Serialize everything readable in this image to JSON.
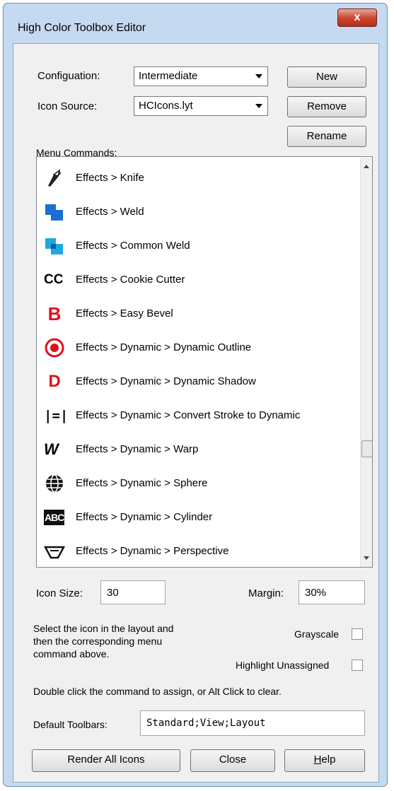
{
  "window": {
    "title": "High Color Toolbox Editor",
    "close_glyph": "x"
  },
  "config": {
    "configuration_label": "Configuation:",
    "configuration_value": "Intermediate",
    "icon_source_label": "Icon Source:",
    "icon_source_value": "HCIcons.lyt"
  },
  "buttons": {
    "new": "New",
    "remove": "Remove",
    "rename": "Rename",
    "render_all": "Render All Icons",
    "close": "Close",
    "help_prefix": "H",
    "help_rest": "elp"
  },
  "menu_commands": {
    "label": "Menu Commands:",
    "items": [
      {
        "icon": "knife-icon",
        "label": "Effects  >  Knife"
      },
      {
        "icon": "weld-icon",
        "label": "Effects  >  Weld"
      },
      {
        "icon": "common-weld-icon",
        "label": "Effects  >  Common Weld"
      },
      {
        "icon": "cookie-cutter-icon",
        "label": "Effects  >  Cookie Cutter"
      },
      {
        "icon": "easy-bevel-icon",
        "label": "Effects  >  Easy Bevel"
      },
      {
        "icon": "dynamic-outline-icon",
        "label": "Effects  >  Dynamic  >  Dynamic Outline"
      },
      {
        "icon": "dynamic-shadow-icon",
        "label": "Effects  >  Dynamic  >  Dynamic Shadow"
      },
      {
        "icon": "convert-stroke-icon",
        "label": "Effects  >  Dynamic  >  Convert Stroke to Dynamic"
      },
      {
        "icon": "warp-icon",
        "label": "Effects  >  Dynamic  >  Warp"
      },
      {
        "icon": "sphere-icon",
        "label": "Effects  >  Dynamic  >  Sphere"
      },
      {
        "icon": "cylinder-icon",
        "label": "Effects  >  Dynamic  >  Cylinder"
      },
      {
        "icon": "perspective-icon",
        "label": "Effects  >  Dynamic  >  Perspective"
      }
    ],
    "icon_text": {
      "cookie_cutter": "CC",
      "easy_bevel": "B",
      "dynamic_shadow": "D",
      "convert_stroke": "|=|",
      "warp": "W",
      "cylinder": "ABC"
    }
  },
  "settings": {
    "icon_size_label": "Icon Size:",
    "icon_size_value": "30",
    "margin_label": "Margin:",
    "margin_value": "30%",
    "instruction_line1": "Select the icon in the layout and",
    "instruction_line2": "then the corresponding menu",
    "instruction_line3": "command above.",
    "grayscale_label": "Grayscale",
    "highlight_label": "Highlight Unassigned",
    "double_click_hint": "Double click the command to assign, or Alt Click to clear.",
    "default_toolbars_label": "Default Toolbars:",
    "default_toolbars_value": "Standard;View;Layout"
  },
  "colors": {
    "frame": "#c5daf1",
    "close_button": "#cc4a35",
    "icon_blue": "#1a6fd0",
    "icon_cyan": "#1fa8e0",
    "icon_red": "#e0101a"
  }
}
